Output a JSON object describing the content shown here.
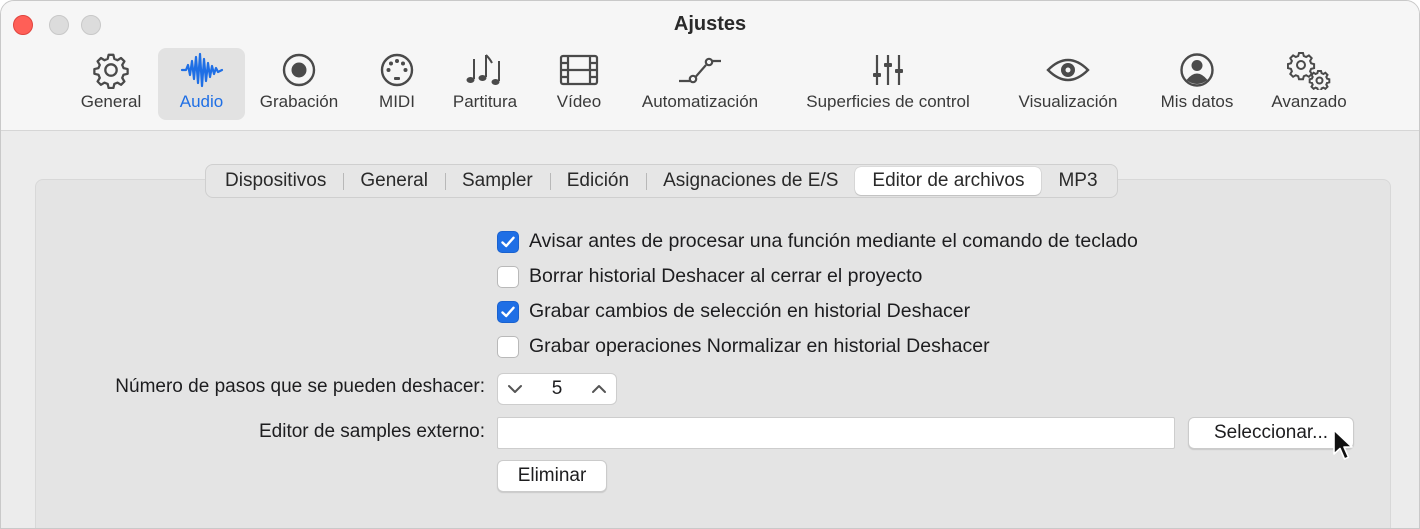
{
  "window": {
    "title": "Ajustes"
  },
  "toolbar": {
    "selected": "Audio",
    "accent_color": "#1f6fe5",
    "items": [
      {
        "label": "General",
        "icon": "gear-icon"
      },
      {
        "label": "Audio",
        "icon": "waveform-icon"
      },
      {
        "label": "Grabación",
        "icon": "record-icon"
      },
      {
        "label": "MIDI",
        "icon": "midi-port-icon"
      },
      {
        "label": "Partitura",
        "icon": "music-notes-icon"
      },
      {
        "label": "Vídeo",
        "icon": "film-icon"
      },
      {
        "label": "Automatización",
        "icon": "automation-curve-icon"
      },
      {
        "label": "Superficies de control",
        "icon": "sliders-icon"
      },
      {
        "label": "Visualización",
        "icon": "eye-icon"
      },
      {
        "label": "Mis datos",
        "icon": "person-icon"
      },
      {
        "label": "Avanzado",
        "icon": "gears-icon"
      }
    ]
  },
  "tabs": {
    "active": "Editor de archivos",
    "items": [
      "Dispositivos",
      "General",
      "Sampler",
      "Edición",
      "Asignaciones de E/S",
      "Editor de archivos",
      "MP3"
    ]
  },
  "options": [
    {
      "label": "Avisar antes de procesar una función mediante el comando de teclado",
      "checked": true
    },
    {
      "label": "Borrar historial Deshacer al cerrar el proyecto",
      "checked": false
    },
    {
      "label": "Grabar cambios de selección en historial Deshacer",
      "checked": true
    },
    {
      "label": "Grabar operaciones Normalizar en historial Deshacer",
      "checked": false
    }
  ],
  "undo_steps": {
    "label": "Número de pasos que se pueden deshacer:",
    "value": "5"
  },
  "external_editor": {
    "label": "Editor de samples externo:",
    "value": "",
    "select_button": "Seleccionar...",
    "remove_button": "Eliminar"
  }
}
